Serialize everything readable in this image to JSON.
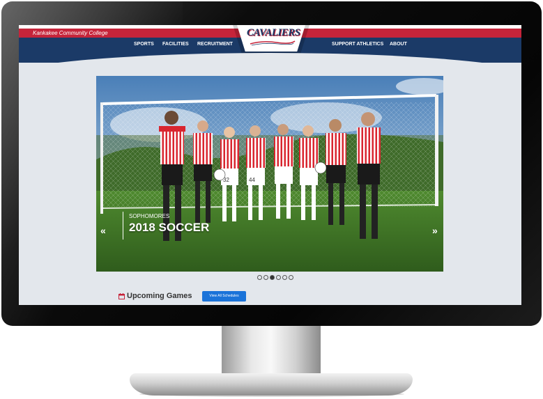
{
  "header": {
    "college_name": "Kankakee Community College",
    "logo_text": "CAVALIERS",
    "colors": {
      "red": "#c6243a",
      "navy": "#1b3a67"
    }
  },
  "nav": {
    "left": [
      "SPORTS",
      "FACILITIES",
      "RECRUITMENT"
    ],
    "right": [
      "SUPPORT ATHLETICS",
      "ABOUT"
    ]
  },
  "hero": {
    "subtitle": "SOPHOMORES",
    "title": "2018 SOCCER",
    "prev_icon": "«",
    "next_icon": "»",
    "slide_count": 6,
    "active_slide": 3,
    "jersey_numbers": [
      "32",
      "44"
    ]
  },
  "games": {
    "title": "Upcoming Games",
    "button_label": "View All Schedules",
    "icon": "calendar-icon"
  }
}
